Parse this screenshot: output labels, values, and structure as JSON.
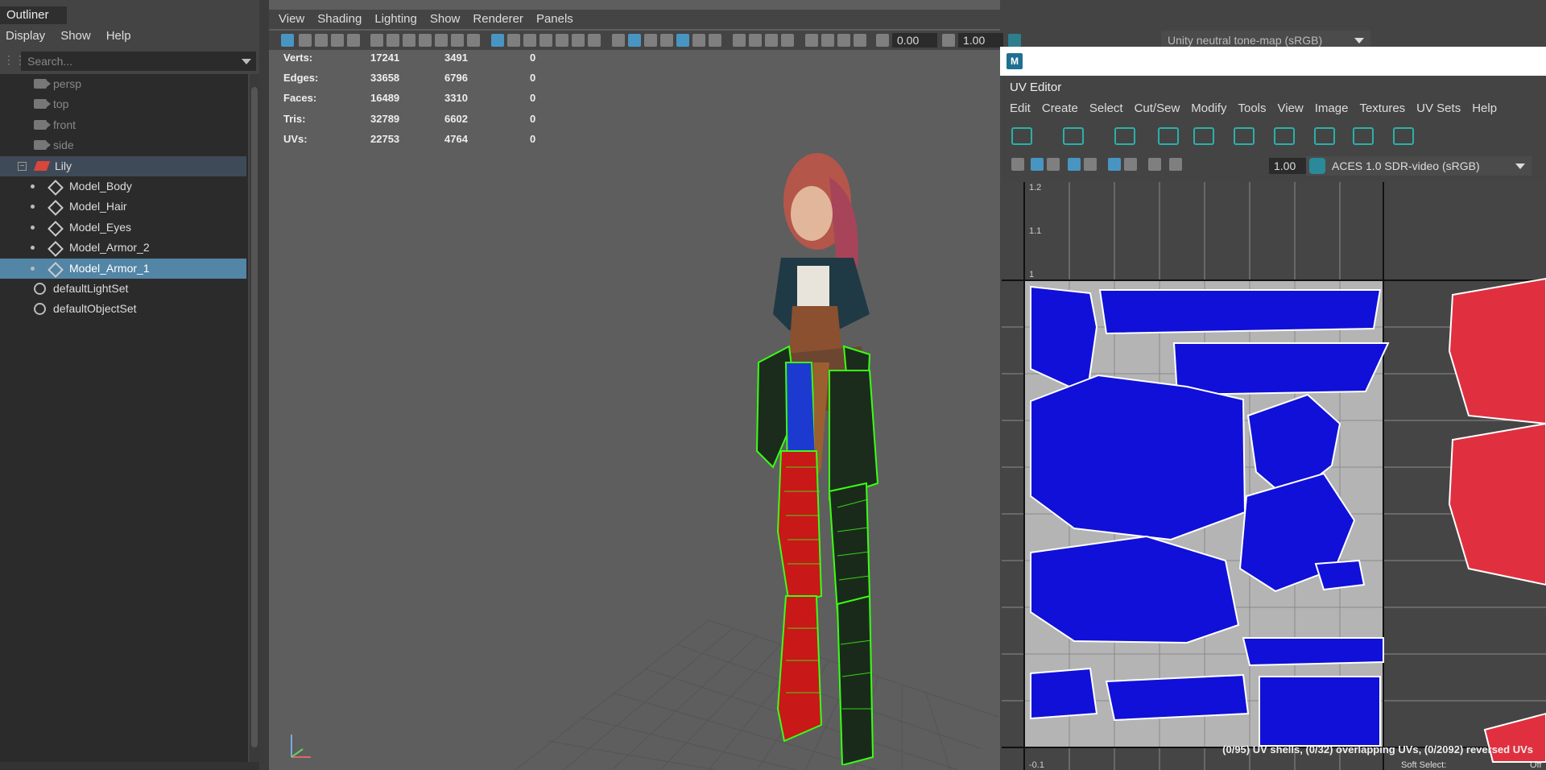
{
  "outliner": {
    "tab_title": "Outliner",
    "menu": [
      "Display",
      "Show",
      "Help"
    ],
    "search_placeholder": "Search...",
    "items": [
      {
        "label": "persp",
        "type": "camera",
        "indent": 0
      },
      {
        "label": "top",
        "type": "camera",
        "indent": 0
      },
      {
        "label": "front",
        "type": "camera",
        "indent": 0
      },
      {
        "label": "side",
        "type": "camera",
        "indent": 0
      },
      {
        "label": "Lily",
        "type": "group",
        "indent": 0
      },
      {
        "label": "Model_Body",
        "type": "mesh",
        "indent": 1
      },
      {
        "label": "Model_Hair",
        "type": "mesh",
        "indent": 1
      },
      {
        "label": "Model_Eyes",
        "type": "mesh",
        "indent": 1
      },
      {
        "label": "Model_Armor_2",
        "type": "mesh",
        "indent": 1
      },
      {
        "label": "Model_Armor_1",
        "type": "mesh",
        "indent": 1,
        "selected": true
      },
      {
        "label": "defaultLightSet",
        "type": "set",
        "indent": 0
      },
      {
        "label": "defaultObjectSet",
        "type": "set",
        "indent": 0
      }
    ]
  },
  "viewport": {
    "menu": [
      "View",
      "Shading",
      "Lighting",
      "Show",
      "Renderer",
      "Panels"
    ],
    "exposure_value": "0.00",
    "gamma_value": "1.00",
    "tone_map": "Unity neutral tone-map (sRGB)",
    "hud": [
      {
        "label": "Verts:",
        "total": "17241",
        "selected": "3491",
        "extra": "0"
      },
      {
        "label": "Edges:",
        "total": "33658",
        "selected": "6796",
        "extra": "0"
      },
      {
        "label": "Faces:",
        "total": "16489",
        "selected": "3310",
        "extra": "0"
      },
      {
        "label": "Tris:",
        "total": "32789",
        "selected": "6602",
        "extra": "0"
      },
      {
        "label": "UVs:",
        "total": "22753",
        "selected": "4764",
        "extra": "0"
      }
    ]
  },
  "uv_editor": {
    "window_logo": "M",
    "tab_title": "UV Editor",
    "menu": [
      "Edit",
      "Create",
      "Select",
      "Cut/Sew",
      "Modify",
      "Tools",
      "View",
      "Image",
      "Textures",
      "UV Sets",
      "Help"
    ],
    "gamma_value": "1.00",
    "color_space": "ACES 1.0 SDR-video (sRGB)",
    "grid_labels": [
      "1.2",
      "1.1",
      "1",
      "-0.1"
    ],
    "status": "(0/95) UV shells, (0/32) overlapping UVs, (0/2092) reversed UVs",
    "soft_select": "Soft Select:",
    "soft_select_value": "Off"
  },
  "colors": {
    "selection": "#5285a6",
    "uv_shell": "#1010d8",
    "uv_reversed": "#e03040",
    "wire_green": "#39ff14",
    "wire_red": "#e8141e"
  }
}
